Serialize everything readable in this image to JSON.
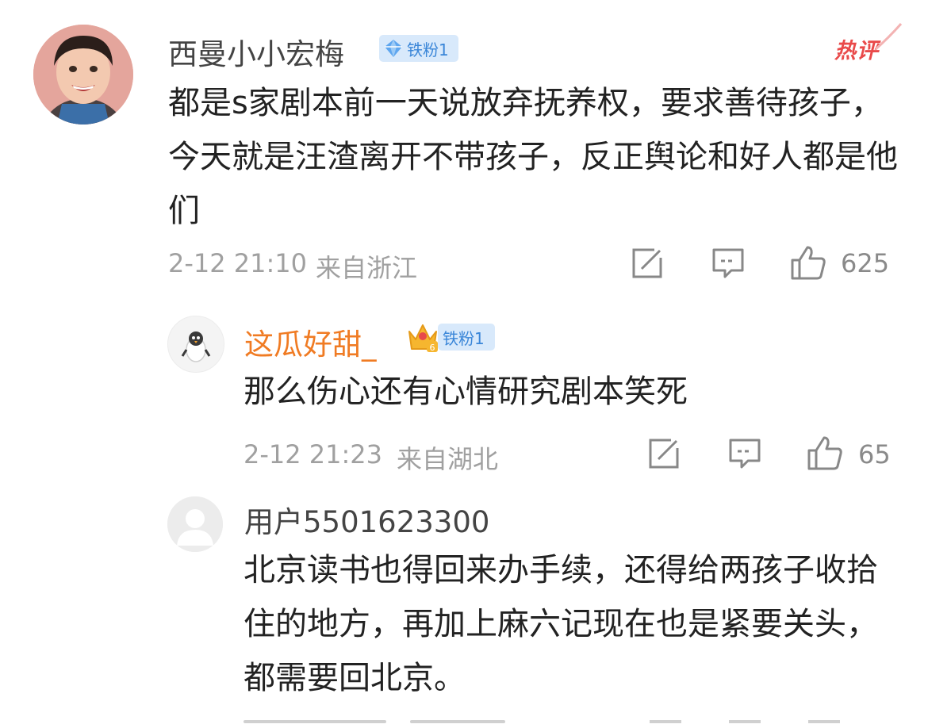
{
  "comment": {
    "username": "西曼小小宏梅",
    "badge": "铁粉1",
    "hot_label": "热评",
    "text": "都是s家剧本前一天说放弃抚养权，要求善待孩子，今天就是汪渣离开不带孩子，反正舆论和好人都是他们",
    "time": "2-12 21:10",
    "location": "来自浙江",
    "likes": "625"
  },
  "replies": [
    {
      "username": "这瓜好甜_",
      "badge": "铁粉1",
      "crown_level": "6",
      "text": "那么伤心还有心情研究剧本笑死",
      "time": "2-12 21:23",
      "location": "来自湖北",
      "likes": "65"
    },
    {
      "username": "用户5501623300",
      "text": "北京读书也得回来办手续，还得给两孩子收拾住的地方，再加上麻六记现在也是紧要关头，都需要回北京。"
    }
  ],
  "colors": {
    "username": "#444444",
    "vip_username": "#f07b23",
    "badge_bg": "#d8e9fb",
    "badge_text": "#3a86d8",
    "hot": "#e94a4a",
    "meta": "#a0a0a0"
  }
}
